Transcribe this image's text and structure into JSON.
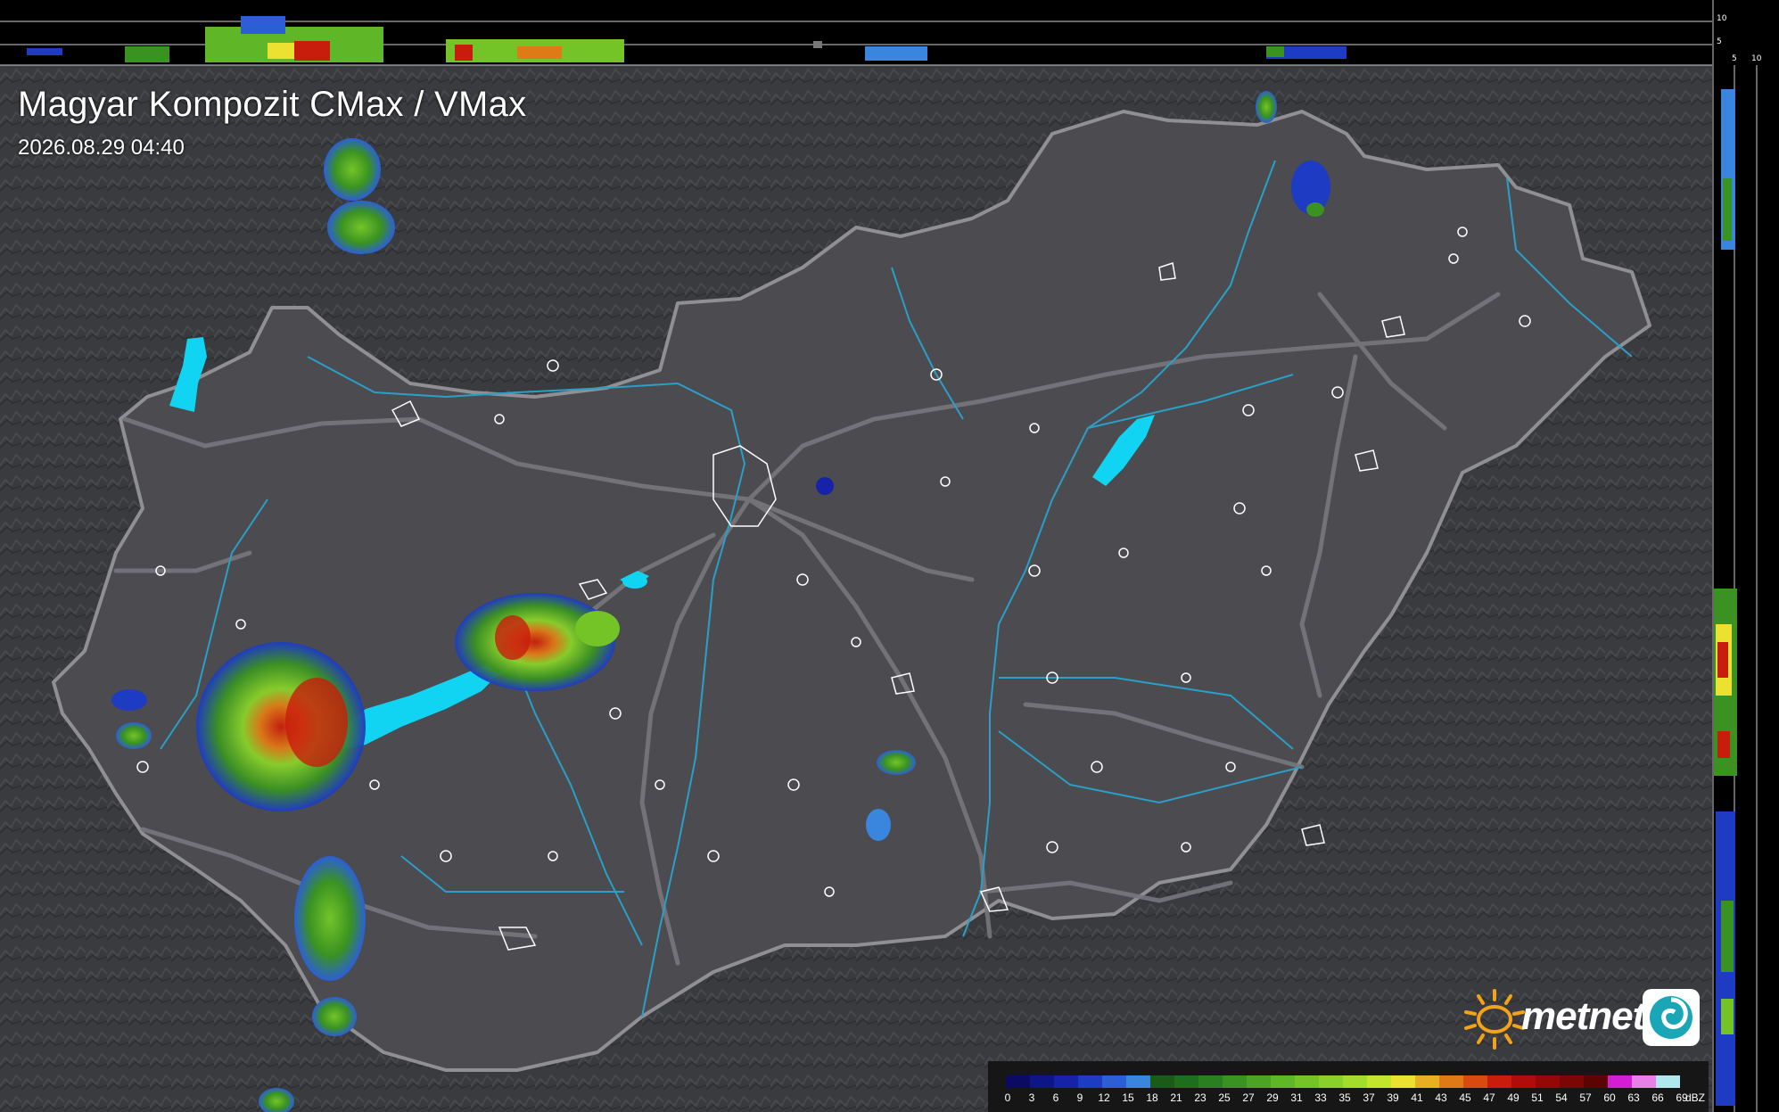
{
  "header": {
    "title": "Magyar Kompozit CMax / VMax",
    "timestamp": "2026.08.29 04:40"
  },
  "profile_scales": {
    "top_labels": [
      "10",
      "5"
    ],
    "right_labels": [
      "5",
      "10"
    ]
  },
  "logo": {
    "text": "metnet",
    "icon": "sun-icon",
    "badge_icon": "swirl-icon"
  },
  "legend": {
    "unit": "dBZ",
    "values": [
      "0",
      "3",
      "6",
      "9",
      "12",
      "15",
      "18",
      "21",
      "23",
      "25",
      "27",
      "29",
      "31",
      "33",
      "35",
      "37",
      "39",
      "41",
      "43",
      "45",
      "47",
      "49",
      "51",
      "54",
      "57",
      "60",
      "63",
      "66",
      "69"
    ],
    "colors": [
      "#0b0b63",
      "#0e1686",
      "#1623a8",
      "#1e3bc4",
      "#2c5fd6",
      "#3a86de",
      "#1a5b1a",
      "#1d6e1d",
      "#2a8020",
      "#3a9222",
      "#4da424",
      "#5fb626",
      "#74c428",
      "#8ad22a",
      "#a4dc2c",
      "#c2e52e",
      "#ece130",
      "#e8b020",
      "#e07a16",
      "#d84a10",
      "#c81d0c",
      "#b00c0c",
      "#960808",
      "#7a0606",
      "#5c0404",
      "#d41ed4",
      "#e880e8",
      "#b0e8f0"
    ]
  },
  "colors": {
    "terrain": "#3a3b3e",
    "country_fill": "#4b4b50",
    "country_border": "#8f8f94",
    "roads": "#77777c",
    "rivers": "#2a9fc8",
    "lakes": "#10d4f2",
    "towns": "#ffffff"
  }
}
